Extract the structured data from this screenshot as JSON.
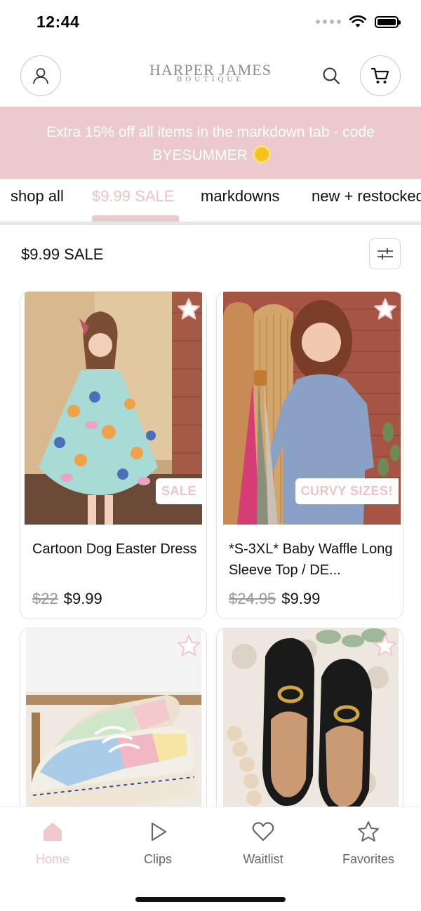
{
  "status": {
    "time": "12:44"
  },
  "header": {
    "logo_main": "HARPER JAMES",
    "logo_sub": "BOUTIQUE"
  },
  "promo": {
    "line1": "Extra 15% off all items in the markdown tab - code",
    "line2": "BYESUMMER"
  },
  "tabs": [
    {
      "label": "shop all"
    },
    {
      "label": "$9.99 SALE"
    },
    {
      "label": "markdowns"
    },
    {
      "label": "new + restocked"
    }
  ],
  "active_tab": "$9.99 SALE",
  "section": {
    "title": "$9.99 SALE"
  },
  "products": [
    {
      "title": "Cartoon Dog Easter Dress",
      "old_price": "$22",
      "price": "$9.99",
      "badge": "SALE"
    },
    {
      "title": "*S-3XL* Baby Waffle Long Sleeve Top / DE...",
      "old_price": "$24.95",
      "price": "$9.99",
      "badge": "CURVY SIZES!"
    },
    {
      "title": "",
      "old_price": "",
      "price": "",
      "badge": ""
    },
    {
      "title": "",
      "old_price": "",
      "price": "",
      "badge": ""
    }
  ],
  "nav": [
    {
      "label": "Home",
      "icon": "home-icon"
    },
    {
      "label": "Clips",
      "icon": "play-icon"
    },
    {
      "label": "Waitlist",
      "icon": "heart-icon"
    },
    {
      "label": "Favorites",
      "icon": "star-icon"
    }
  ],
  "colors": {
    "accent_pink": "#ecc9cc",
    "active_text": "#eec3c6",
    "text": "#111111"
  }
}
